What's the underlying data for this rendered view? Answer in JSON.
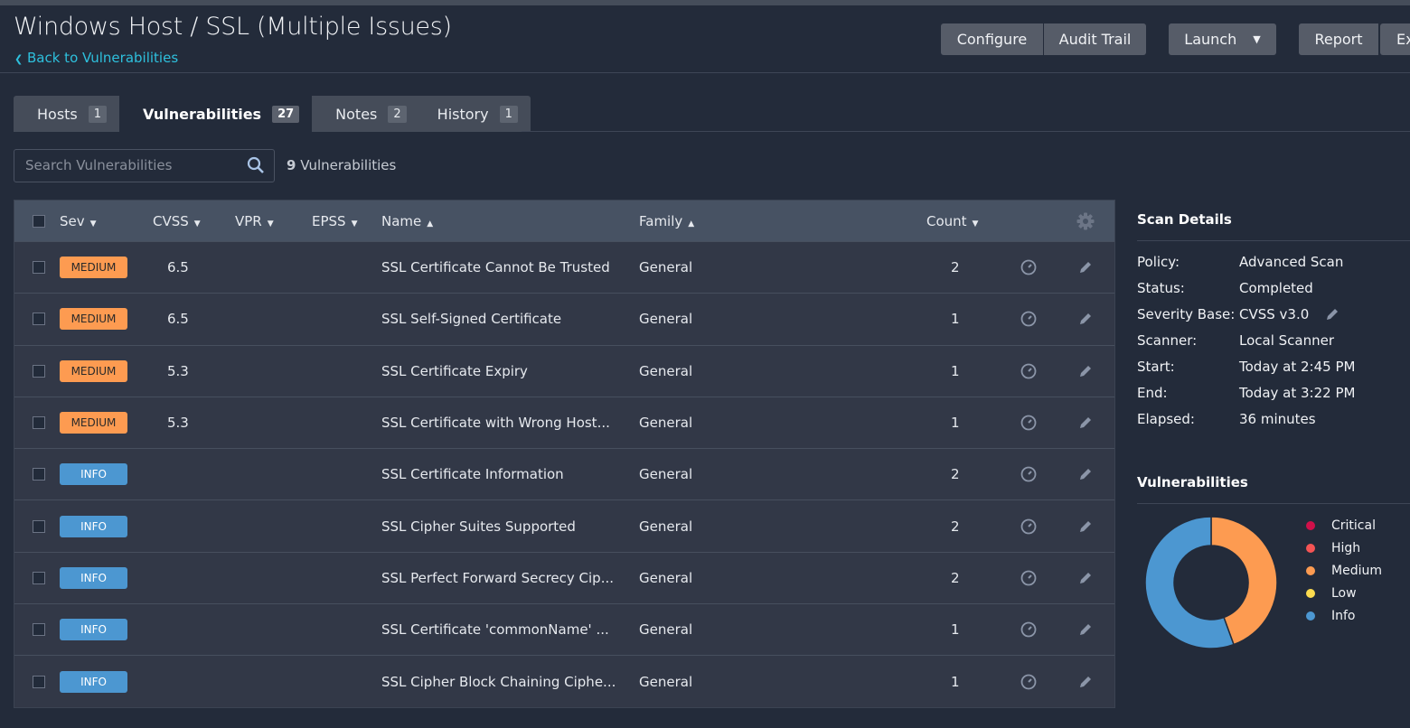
{
  "header": {
    "title": "Windows Host / SSL (Multiple Issues)",
    "back_link": "Back to Vulnerabilities"
  },
  "toolbar": {
    "configure": "Configure",
    "audit_trail": "Audit Trail",
    "launch": "Launch",
    "report": "Report",
    "export": "Ex"
  },
  "tabs": [
    {
      "label": "Hosts",
      "count": "1"
    },
    {
      "label": "Vulnerabilities",
      "count": "27"
    },
    {
      "label": "Notes",
      "count": "2"
    },
    {
      "label": "History",
      "count": "1"
    }
  ],
  "search": {
    "placeholder": "Search Vulnerabilities",
    "count_num": "9",
    "count_label": "Vulnerabilities"
  },
  "table": {
    "columns": {
      "sev": "Sev",
      "cvss": "CVSS",
      "vpr": "VPR",
      "epss": "EPSS",
      "name": "Name",
      "family": "Family",
      "count": "Count"
    },
    "rows": [
      {
        "sev": "MEDIUM",
        "cvss": "6.5",
        "name": "SSL Certificate Cannot Be Trusted",
        "family": "General",
        "count": "2"
      },
      {
        "sev": "MEDIUM",
        "cvss": "6.5",
        "name": "SSL Self-Signed Certificate",
        "family": "General",
        "count": "1"
      },
      {
        "sev": "MEDIUM",
        "cvss": "5.3",
        "name": "SSL Certificate Expiry",
        "family": "General",
        "count": "1"
      },
      {
        "sev": "MEDIUM",
        "cvss": "5.3",
        "name": "SSL Certificate with Wrong Host...",
        "family": "General",
        "count": "1"
      },
      {
        "sev": "INFO",
        "cvss": "",
        "name": "SSL Certificate Information",
        "family": "General",
        "count": "2"
      },
      {
        "sev": "INFO",
        "cvss": "",
        "name": "SSL Cipher Suites Supported",
        "family": "General",
        "count": "2"
      },
      {
        "sev": "INFO",
        "cvss": "",
        "name": "SSL Perfect Forward Secrecy Cip...",
        "family": "General",
        "count": "2"
      },
      {
        "sev": "INFO",
        "cvss": "",
        "name": "SSL Certificate 'commonName' ...",
        "family": "General",
        "count": "1"
      },
      {
        "sev": "INFO",
        "cvss": "",
        "name": "SSL Cipher Block Chaining Ciphe...",
        "family": "General",
        "count": "1"
      }
    ]
  },
  "scan_details": {
    "title": "Scan Details",
    "items": [
      {
        "label": "Policy:",
        "value": "Advanced Scan"
      },
      {
        "label": "Status:",
        "value": "Completed"
      },
      {
        "label": "Severity Base:",
        "value": "CVSS v3.0"
      },
      {
        "label": "Scanner:",
        "value": "Local Scanner"
      },
      {
        "label": "Start:",
        "value": "Today at 2:45 PM"
      },
      {
        "label": "End:",
        "value": "Today at 3:22 PM"
      },
      {
        "label": "Elapsed:",
        "value": "36 minutes"
      }
    ]
  },
  "chart_data": {
    "type": "pie",
    "title": "Vulnerabilities",
    "categories": [
      "Critical",
      "High",
      "Medium",
      "Low",
      "Info"
    ],
    "values": [
      0,
      0,
      4,
      0,
      5
    ],
    "colors": [
      "#d0104a",
      "#f55454",
      "#fd9b51",
      "#fddc4f",
      "#4c97d1"
    ],
    "legend": "right"
  }
}
